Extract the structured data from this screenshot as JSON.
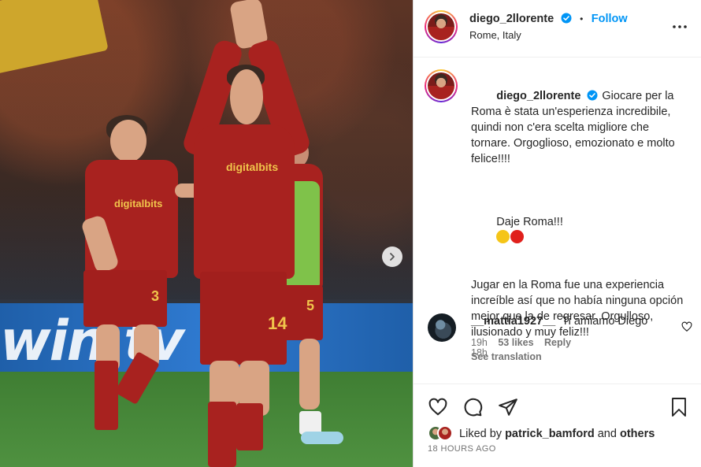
{
  "photo": {
    "board_text": "win.tv",
    "left_player": {
      "sponsor": "digitalbits",
      "number": "3"
    },
    "center_player": {
      "sponsor": "digitalbits",
      "number": "14"
    },
    "right_player": {
      "number": "5"
    },
    "next_icon": "chevron-right-icon"
  },
  "header": {
    "username": "diego_2llorente",
    "separator": "•",
    "follow_label": "Follow",
    "location": "Rome, Italy",
    "more_icon": "more-options-icon"
  },
  "caption": {
    "username": "diego_2llorente",
    "paragraph_1": "Giocare per la Roma è stata un'esperienza incredibile, quindi non c'era scelta migliore che tornare. Orgoglioso, emozionato e molto felice!!!!",
    "paragraph_2": "Daje Roma!!!",
    "paragraph_3": "Jugar en la Roma fue una experiencia increíble así que no había ninguna opción mejor que la de regresar. Orgulloso, ilusionado y muy feliz!!!",
    "time": "18h",
    "emoji_colors": [
      "#f5c518",
      "#e0201c"
    ]
  },
  "comment": {
    "username": "__mattia1927__",
    "text": "Ti amiamo Diego",
    "time": "19h",
    "likes": "53 likes",
    "reply_label": "Reply",
    "see_translation": "See translation"
  },
  "actions": {
    "like_icon": "heart-icon",
    "comment_icon": "comment-icon",
    "share_icon": "send-icon",
    "save_icon": "bookmark-icon"
  },
  "likes": {
    "prefix": "Liked by",
    "user": "patrick_bamford",
    "conj": "and",
    "others": "others"
  },
  "posted": "18 HOURS AGO",
  "colors": {
    "accent": "#0095f6",
    "muted": "#737373",
    "roma_red": "#a8221f",
    "roma_gold": "#f0c44b"
  }
}
